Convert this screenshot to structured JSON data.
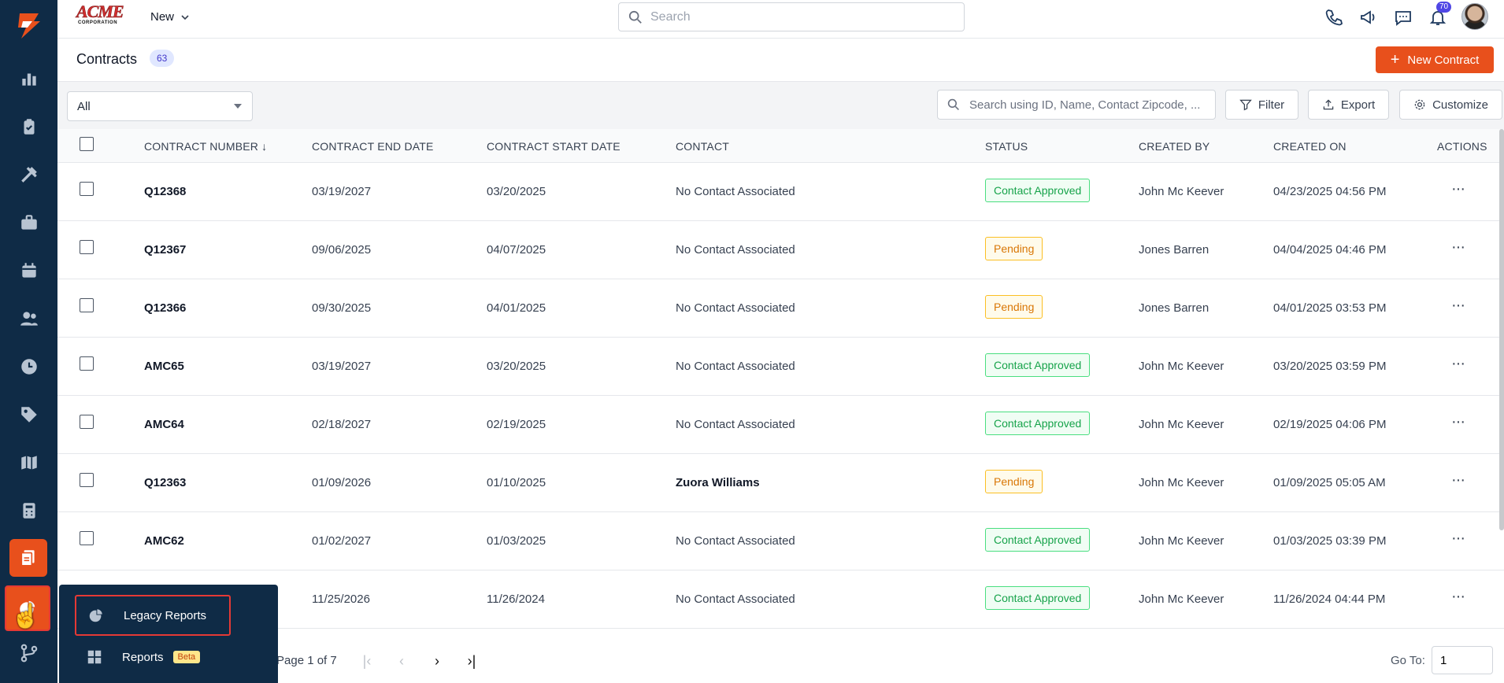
{
  "brand": {
    "name": "ACME",
    "subtitle": "CORPORATION"
  },
  "topbar": {
    "new_label": "New",
    "search_placeholder": "Search",
    "notification_count": "70"
  },
  "page": {
    "title": "Contracts",
    "count": "63",
    "new_button": "New Contract"
  },
  "filters": {
    "view_selected": "All",
    "search_placeholder": "Search using ID, Name, Contact Zipcode, ...",
    "filter_label": "Filter",
    "export_label": "Export",
    "customize_label": "Customize"
  },
  "table": {
    "columns": [
      "CONTRACT NUMBER",
      "CONTRACT END DATE",
      "CONTRACT START DATE",
      "CONTACT",
      "STATUS",
      "CREATED BY",
      "CREATED ON",
      "ACTIONS"
    ],
    "rows": [
      {
        "number": "Q12368",
        "end": "03/19/2027",
        "start": "03/20/2025",
        "contact": "No Contact Associated",
        "status": "Contact Approved",
        "created_by": "John Mc Keever",
        "created_on": "04/23/2025 04:56 PM"
      },
      {
        "number": "Q12367",
        "end": "09/06/2025",
        "start": "04/07/2025",
        "contact": "No Contact Associated",
        "status": "Pending",
        "created_by": "Jones Barren",
        "created_on": "04/04/2025 04:46 PM"
      },
      {
        "number": "Q12366",
        "end": "09/30/2025",
        "start": "04/01/2025",
        "contact": "No Contact Associated",
        "status": "Pending",
        "created_by": "Jones Barren",
        "created_on": "04/01/2025 03:53 PM"
      },
      {
        "number": "AMC65",
        "end": "03/19/2027",
        "start": "03/20/2025",
        "contact": "No Contact Associated",
        "status": "Contact Approved",
        "created_by": "John Mc Keever",
        "created_on": "03/20/2025 03:59 PM"
      },
      {
        "number": "AMC64",
        "end": "02/18/2027",
        "start": "02/19/2025",
        "contact": "No Contact Associated",
        "status": "Contact Approved",
        "created_by": "John Mc Keever",
        "created_on": "02/19/2025 04:06 PM"
      },
      {
        "number": "Q12363",
        "end": "01/09/2026",
        "start": "01/10/2025",
        "contact": "Zuora Williams",
        "status": "Pending",
        "created_by": "John Mc Keever",
        "created_on": "01/09/2025 05:05 AM"
      },
      {
        "number": "AMC62",
        "end": "01/02/2027",
        "start": "01/03/2025",
        "contact": "No Contact Associated",
        "status": "Contact Approved",
        "created_by": "John Mc Keever",
        "created_on": "01/03/2025 03:39 PM"
      },
      {
        "number": "",
        "end": "11/25/2026",
        "start": "11/26/2024",
        "contact": "No Contact Associated",
        "status": "Contact Approved",
        "created_by": "John Mc Keever",
        "created_on": "11/26/2024 04:44 PM"
      }
    ]
  },
  "pagination": {
    "page_label": "Page 1 of 7",
    "goto_label": "Go To:",
    "goto_value": "1"
  },
  "flyout": {
    "legacy_reports": "Legacy Reports",
    "reports": "Reports",
    "beta": "Beta"
  },
  "colors": {
    "sidebar": "#0f2b46",
    "accent": "#e8501c",
    "approved": "#16a34a",
    "pending": "#d97706"
  }
}
